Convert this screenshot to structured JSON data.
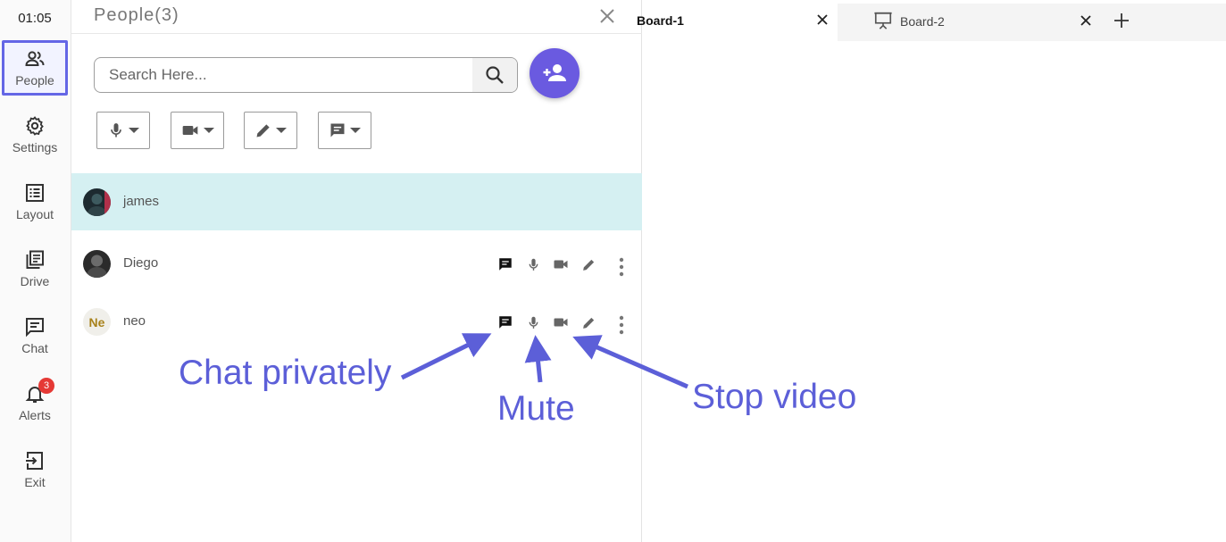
{
  "rail": {
    "clock": "01:05",
    "items": [
      {
        "label": "People",
        "icon": "people-icon",
        "active": true
      },
      {
        "label": "Settings",
        "icon": "gear-icon"
      },
      {
        "label": "Layout",
        "icon": "layout-icon"
      },
      {
        "label": "Drive",
        "icon": "drive-icon"
      },
      {
        "label": "Chat",
        "icon": "chat-icon"
      },
      {
        "label": "Alerts",
        "icon": "bell-icon",
        "badge": "3"
      },
      {
        "label": "Exit",
        "icon": "exit-icon"
      }
    ]
  },
  "panel": {
    "title": "People(3)",
    "search_placeholder": "Search Here...",
    "filters": [
      "mic-filter",
      "video-filter",
      "pencil-filter",
      "chat-filter"
    ],
    "people": [
      {
        "name": "james",
        "highlight": true
      },
      {
        "name": "Diego"
      },
      {
        "name": "neo",
        "initials": "Ne"
      }
    ]
  },
  "tabs": {
    "board1": "Board-1",
    "board2": "Board-2"
  },
  "annotations": {
    "chat": "Chat privately",
    "mute": "Mute",
    "video": "Stop video"
  },
  "colors": {
    "accent": "#6466e6",
    "fab": "#6a5ae0",
    "highlight_row": "#d5f0f2",
    "annotation": "#5c5fd8",
    "badge": "#e53935"
  }
}
